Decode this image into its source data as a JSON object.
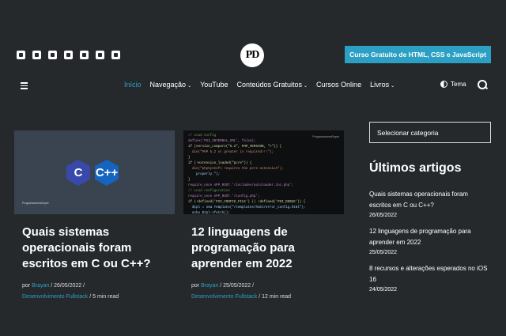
{
  "header": {
    "social_icons": [
      "facebook-icon",
      "twitter-icon",
      "youtube-icon",
      "instagram-icon",
      "telegram-icon",
      "github-icon",
      "rss-icon"
    ],
    "logo_text": "PD",
    "cta_label": "Curso Gratuito de HTML, CSS e JavaScript"
  },
  "nav": {
    "items": [
      {
        "label": "Início",
        "active": true,
        "dropdown": false
      },
      {
        "label": "Navegação",
        "dropdown": true
      },
      {
        "label": "YouTube",
        "dropdown": false
      },
      {
        "label": "Conteúdos Gratuitos",
        "dropdown": true
      },
      {
        "label": "Cursos Online",
        "dropdown": false
      },
      {
        "label": "Livros",
        "dropdown": true
      }
    ],
    "theme_label": "Tema"
  },
  "posts": [
    {
      "title": "Quais sistemas operacionais foram escritos em C ou C++?",
      "by": "por",
      "author": "Brayan",
      "date": "26/05/2022",
      "category": "Desenvolvimento Fullstack",
      "read_time": "5 min read",
      "thumb_tag": "ProgramadoresDepré",
      "thumb_badges": [
        "C",
        "C++"
      ]
    },
    {
      "title": "12 linguagens de programação para aprender em 2022",
      "by": "por",
      "author": "Brayan",
      "date": "25/05/2022",
      "category": "Desenvolvimento Fullstack",
      "read_time": "12 min read",
      "thumb_tag": "ProgramadoresDepré"
    }
  ],
  "sidebar": {
    "category_select_placeholder": "Selecionar categoria",
    "latest_heading": "Últimos artigos",
    "latest": [
      {
        "title": "Quais sistemas operacionais foram escritos em C ou C++?",
        "date": "26/05/2022"
      },
      {
        "title": "12 linguagens de programação para aprender em 2022",
        "date": "25/05/2022"
      },
      {
        "title": "8 recursos e alterações esperados no iOS 16",
        "date": "24/05/2022"
      }
    ]
  },
  "colors": {
    "background": "#26292c",
    "accent": "#2ba0c4"
  }
}
